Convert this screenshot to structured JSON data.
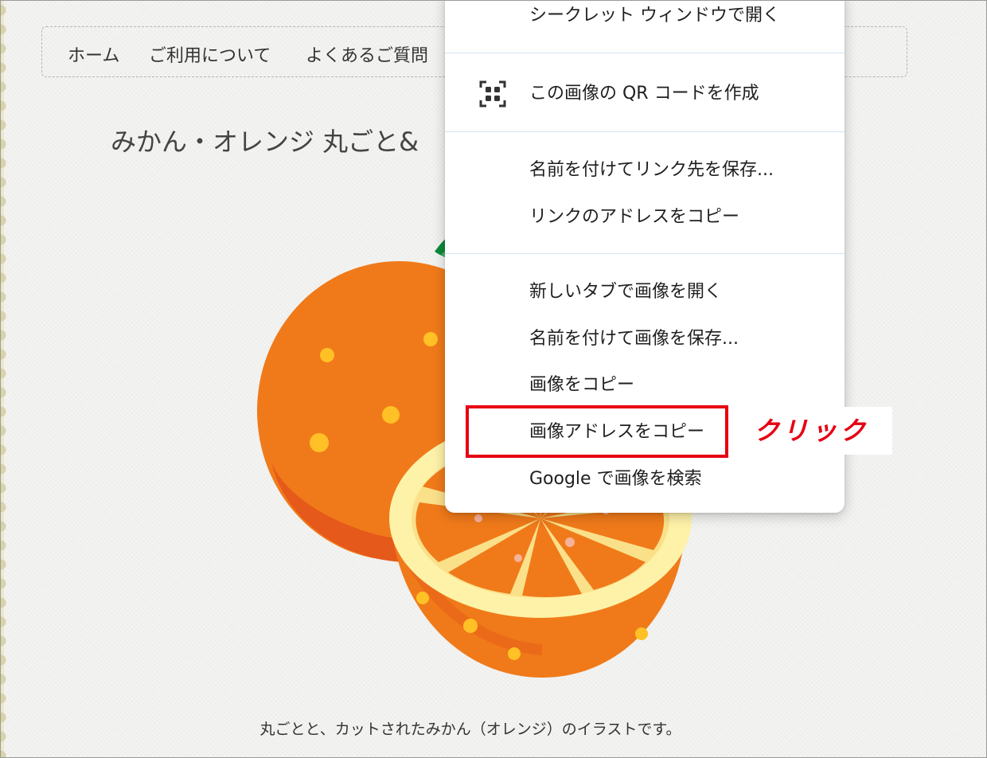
{
  "nav": {
    "items": [
      {
        "label": "ホーム"
      },
      {
        "label": "ご利用について"
      },
      {
        "label": "よくあるご質問"
      }
    ]
  },
  "page": {
    "title": "みかん・オレンジ 丸ごと&",
    "caption": "丸ごとと、カットされたみかん（オレンジ）のイラストです。"
  },
  "context_menu": {
    "items": [
      {
        "label": "シークレット ウィンドウで開く"
      },
      {
        "label": "この画像の QR コードを作成",
        "icon": "qr-code-icon"
      },
      {
        "label": "名前を付けてリンク先を保存..."
      },
      {
        "label": "リンクのアドレスをコピー"
      },
      {
        "label": "新しいタブで画像を開く"
      },
      {
        "label": "名前を付けて画像を保存..."
      },
      {
        "label": "画像をコピー"
      },
      {
        "label": "画像アドレスをコピー",
        "highlighted": true
      },
      {
        "label": "Google で画像を検索"
      }
    ]
  },
  "annotation": {
    "label": "クリック",
    "color": "#e60012"
  },
  "colors": {
    "orange": "#f07a1a",
    "orange_dark": "#e5591a",
    "leaf": "#0c8a3a",
    "rind": "#fdf2a8",
    "highlight": "#e60012"
  }
}
